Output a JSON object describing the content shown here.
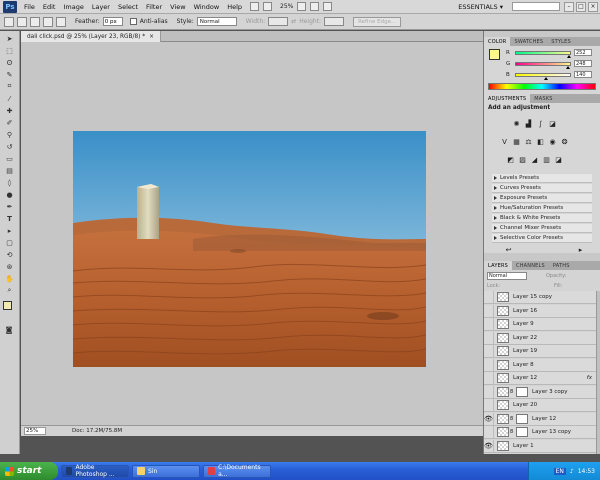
{
  "menubar": {
    "logo": "Ps",
    "menus": [
      "File",
      "Edit",
      "Image",
      "Layer",
      "Select",
      "Filter",
      "View",
      "Window",
      "Help"
    ],
    "zoom": "25%",
    "workspace": "ESSENTIALS ▾"
  },
  "options": {
    "feather_label": "Feather:",
    "feather_value": "0 px",
    "antialias_label": "Anti-alias",
    "style_label": "Style:",
    "style_value": "Normal",
    "width_label": "Width:",
    "height_label": "Height:",
    "refine_label": "Refine Edge..."
  },
  "document": {
    "tab_title": "dali click.psd @ 25% (Layer 23, RGB/8) *",
    "close_glyph": "×"
  },
  "status": {
    "zoom": "25%",
    "doc_size": "Doc: 17.2M/75.8M"
  },
  "color_panel": {
    "tabs": [
      "COLOR",
      "SWATCHES",
      "STYLES"
    ],
    "r_label": "R",
    "g_label": "G",
    "b_label": "B",
    "r": "252",
    "g": "248",
    "b": "140",
    "r_level": 0.99,
    "g_level": 0.97,
    "b_level": 0.55,
    "fg_color": "#fcf88c"
  },
  "adjustments": {
    "tabs": [
      "ADJUSTMENTS",
      "MASKS"
    ],
    "heading": "Add an adjustment",
    "presets": [
      "Levels Presets",
      "Curves Presets",
      "Exposure Presets",
      "Hue/Saturation Presets",
      "Black & White Presets",
      "Channel Mixer Presets",
      "Selective Color Presets"
    ]
  },
  "layers": {
    "tabs": [
      "LAYERS",
      "CHANNELS",
      "PATHS"
    ],
    "blend_mode": "Normal",
    "opacity_label": "Opacity:",
    "lock_label": "Lock:",
    "fill_label": "Fill:",
    "items": [
      {
        "name": "Layer 15 copy",
        "visible": false,
        "mask": false,
        "fx": false,
        "selected": false
      },
      {
        "name": "Layer 16",
        "visible": false,
        "mask": false,
        "fx": false,
        "selected": false
      },
      {
        "name": "Layer 9",
        "visible": false,
        "mask": false,
        "fx": false,
        "selected": false
      },
      {
        "name": "Layer 22",
        "visible": false,
        "mask": false,
        "fx": false,
        "selected": false
      },
      {
        "name": "Layer 19",
        "visible": false,
        "mask": false,
        "fx": false,
        "selected": false
      },
      {
        "name": "Layer 8",
        "visible": false,
        "mask": false,
        "fx": false,
        "selected": false
      },
      {
        "name": "Layer 12",
        "visible": false,
        "mask": false,
        "fx": true,
        "selected": false
      },
      {
        "name": "Layer 3 copy",
        "visible": false,
        "mask": true,
        "fx": false,
        "selected": false
      },
      {
        "name": "Layer 20",
        "visible": false,
        "mask": false,
        "fx": false,
        "selected": false
      },
      {
        "name": "Layer 12",
        "visible": true,
        "mask": true,
        "fx": false,
        "selected": false
      },
      {
        "name": "Layer 13 copy",
        "visible": false,
        "mask": true,
        "fx": false,
        "selected": false
      },
      {
        "name": "Layer 1",
        "visible": true,
        "mask": false,
        "fx": false,
        "selected": false
      }
    ],
    "fx_glyph": "fx"
  },
  "taskbar": {
    "start": "start",
    "items": [
      "Adobe Photoshop ...",
      "Sin",
      "C:\\Documents a..."
    ],
    "lang": "EN",
    "time": "14:53"
  }
}
